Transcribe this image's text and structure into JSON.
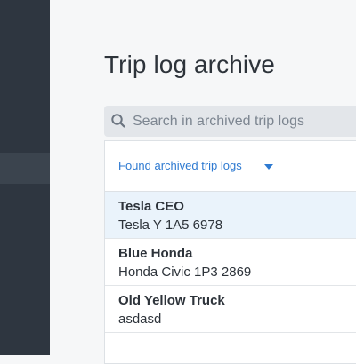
{
  "page": {
    "title": "Trip log archive"
  },
  "search": {
    "placeholder": "Search in archived trip logs",
    "value": ""
  },
  "filter": {
    "label": "Found archived trip logs"
  },
  "trips": [
    {
      "name": "Tesla CEO",
      "vehicle": "Tesla Y 1A5 6978",
      "selected": true
    },
    {
      "name": "Blue Honda",
      "vehicle": "Honda Civic 1P3 2869",
      "selected": false
    },
    {
      "name": "Old Yellow Truck",
      "vehicle": "asdasd",
      "selected": false
    }
  ],
  "colors": {
    "sidebar": "#2e3640",
    "accent": "#2e7ad1",
    "selected_row": "#eaf3fb"
  },
  "icons": {
    "search": "search-icon",
    "dropdown": "chevron-down-icon"
  }
}
